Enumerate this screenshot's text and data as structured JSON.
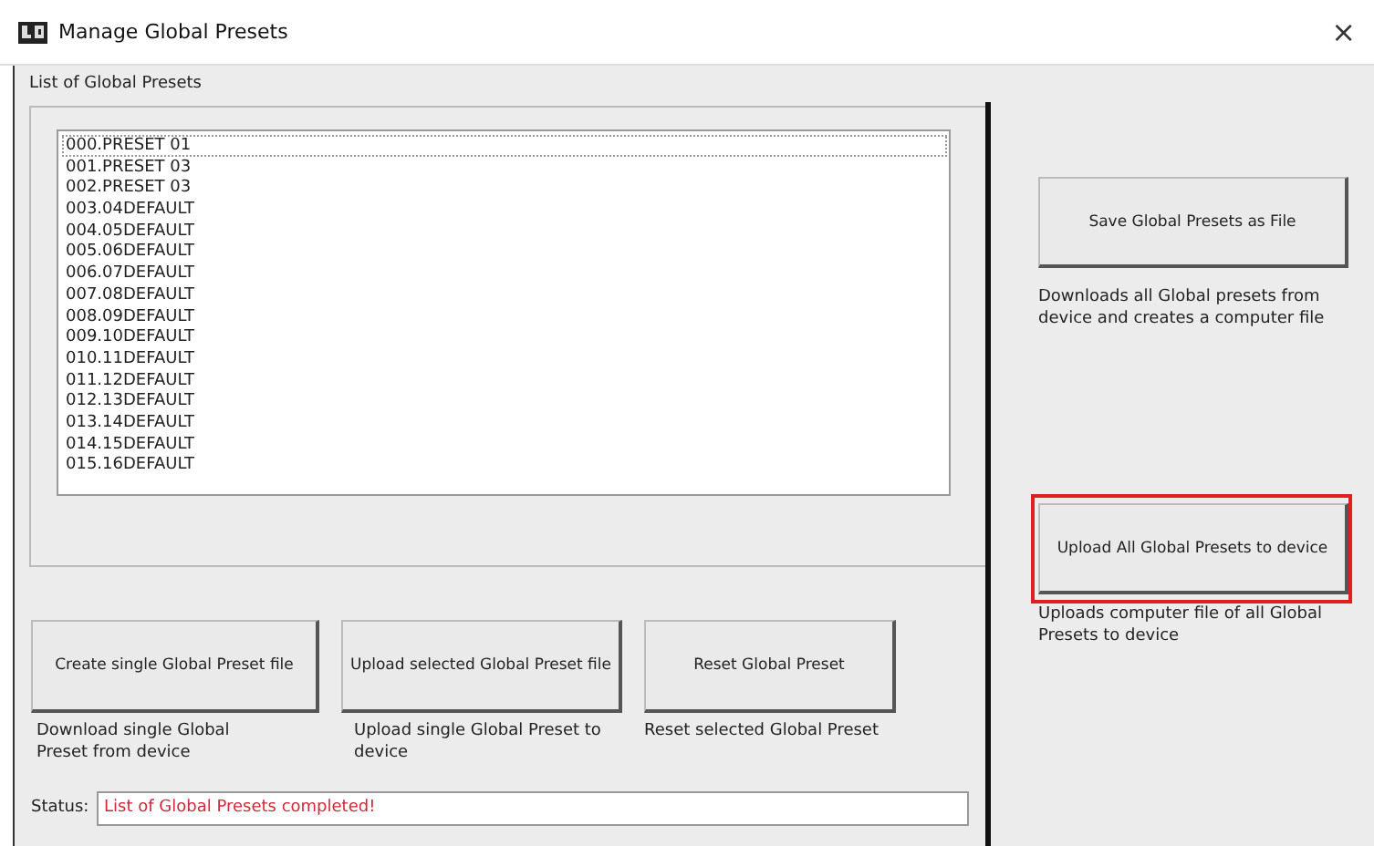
{
  "window": {
    "title": "Manage Global Presets",
    "close": "×"
  },
  "list_label": "List of Global Presets",
  "presets": [
    {
      "label": "000.PRESET 01",
      "selected": true
    },
    {
      "label": "001.PRESET 03",
      "selected": false
    },
    {
      "label": "002.PRESET 03",
      "selected": false
    },
    {
      "label": "003.04DEFAULT",
      "selected": false
    },
    {
      "label": "004.05DEFAULT",
      "selected": false
    },
    {
      "label": "005.06DEFAULT",
      "selected": false
    },
    {
      "label": "006.07DEFAULT",
      "selected": false
    },
    {
      "label": "007.08DEFAULT",
      "selected": false
    },
    {
      "label": "008.09DEFAULT",
      "selected": false
    },
    {
      "label": "009.10DEFAULT",
      "selected": false
    },
    {
      "label": "010.11DEFAULT",
      "selected": false
    },
    {
      "label": "011.12DEFAULT",
      "selected": false
    },
    {
      "label": "012.13DEFAULT",
      "selected": false
    },
    {
      "label": "013.14DEFAULT",
      "selected": false
    },
    {
      "label": "014.15DEFAULT",
      "selected": false
    },
    {
      "label": "015.16DEFAULT",
      "selected": false
    }
  ],
  "actions": [
    {
      "button": "Create single Global Preset file",
      "description": "Download single Global Preset from device"
    },
    {
      "button": "Upload selected Global Preset file",
      "description": "Upload single Global Preset to device"
    },
    {
      "button": "Reset Global Preset",
      "description": "Reset selected Global Preset"
    }
  ],
  "file_actions": [
    {
      "button": "Save Global Presets as File",
      "description": "Downloads all Global presets from device and creates a computer file",
      "highlighted": false
    },
    {
      "button": "Upload All Global Presets to device",
      "description": "Uploads computer file of all Global Presets to device",
      "highlighted": true
    }
  ],
  "status": {
    "label": "Status:",
    "value": "List of Global Presets completed!"
  }
}
